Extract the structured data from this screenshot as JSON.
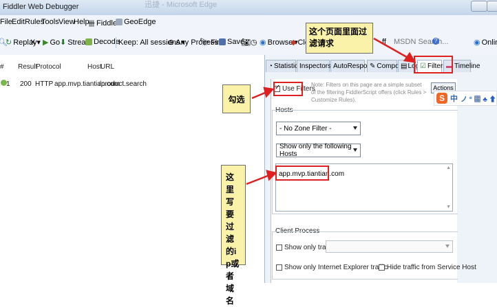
{
  "window": {
    "title": "Fiddler Web Debugger",
    "ghost_title": "迅捷 - Microsoft Edge"
  },
  "menu": [
    "File",
    "Edit",
    "Rules",
    "Tools",
    "View",
    "Help",
    "Fiddler",
    "GeoEdge"
  ],
  "toolbar": {
    "replay": "Replay",
    "remove": "X",
    "go": "Go",
    "stream": "Stream",
    "decode": "Decode",
    "keep_sessions": "Keep: All sessions",
    "any_process": "Any Process",
    "find": "Find",
    "save": "Save",
    "browse": "Browse",
    "clear_cache": "Cle",
    "textwizard": "ff",
    "msdn_search": "MSDN Search...",
    "online": "Online"
  },
  "sessions": {
    "columns": {
      "num": "#",
      "result": "Result",
      "protocol": "Protocol",
      "host": "Host",
      "url": "URL"
    },
    "rows": [
      {
        "num": "1",
        "result": "200",
        "protocol": "HTTP",
        "host": "app.mvp.tiantian.com",
        "url": "/product.search"
      }
    ]
  },
  "tabs": {
    "statistics": "Statistics",
    "inspectors": "Inspectors",
    "autoresponder": "AutoResponder",
    "composer": "Composer",
    "log": "Log",
    "filters": "Filters",
    "timeline": "Timeline"
  },
  "filters": {
    "use_filters": "Use Filters",
    "note": "Note: Filters on this page are a simple subset of the filtering FiddlerScript offers (click Rules > Customize Rules).",
    "actions": "Actions",
    "hosts_label": "Hosts",
    "zone_filter": "- No Zone Filter -",
    "host_filter_mode": "Show only the following Hosts",
    "hosts_value": "app.mvp.tiantian.com",
    "client_process_label": "Client Process",
    "show_only_traffic_from": "Show only traffic from",
    "show_ie_only": "Show only Internet Explorer traffic",
    "hide_service_host": "Hide traffic from Service Host"
  },
  "ime_toolbar": {
    "logo": "S",
    "mode": "中",
    "glyphs": "ノ ° ▦ ♣ ⬆"
  },
  "annotations": {
    "filters_tab_note": "这个页面里面过滤请求",
    "check_note": "勾选",
    "hosts_note": "这里写要过滤的ip或者域名"
  },
  "colors": {
    "annotation_bg": "#f9f2a8",
    "highlight_border": "#e02020",
    "arrow": "#e02020"
  }
}
